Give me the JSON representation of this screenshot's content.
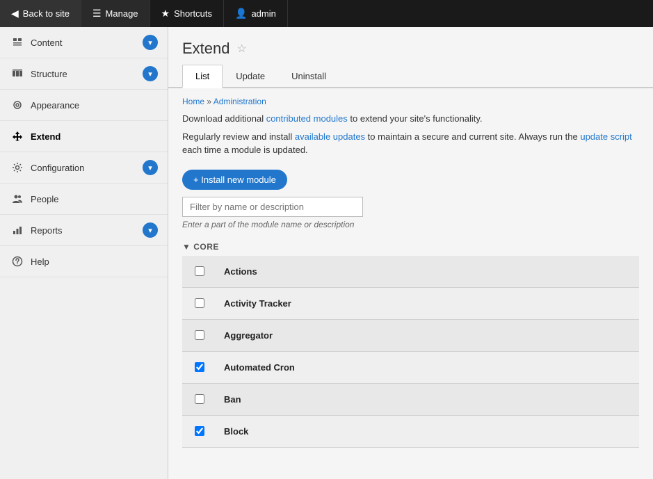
{
  "topNav": {
    "items": [
      {
        "id": "back-to-site",
        "label": "Back to site",
        "icon": "◀",
        "active": false
      },
      {
        "id": "manage",
        "label": "Manage",
        "icon": "☰",
        "active": true
      },
      {
        "id": "shortcuts",
        "label": "Shortcuts",
        "icon": "★",
        "active": false
      },
      {
        "id": "admin",
        "label": "admin",
        "icon": "👤",
        "active": false
      }
    ]
  },
  "sidebar": {
    "items": [
      {
        "id": "content",
        "label": "Content",
        "icon": "📄",
        "hasExpand": true,
        "active": false
      },
      {
        "id": "structure",
        "label": "Structure",
        "icon": "⚙",
        "hasExpand": true,
        "active": false
      },
      {
        "id": "appearance",
        "label": "Appearance",
        "icon": "🎨",
        "hasExpand": false,
        "active": false
      },
      {
        "id": "extend",
        "label": "Extend",
        "icon": "🧩",
        "hasExpand": false,
        "active": true
      },
      {
        "id": "configuration",
        "label": "Configuration",
        "icon": "🔧",
        "hasExpand": true,
        "active": false
      },
      {
        "id": "people",
        "label": "People",
        "icon": "👥",
        "hasExpand": false,
        "active": false
      },
      {
        "id": "reports",
        "label": "Reports",
        "icon": "📊",
        "hasExpand": true,
        "active": false
      },
      {
        "id": "help",
        "label": "Help",
        "icon": "❓",
        "hasExpand": false,
        "active": false
      }
    ]
  },
  "page": {
    "title": "Extend",
    "starLabel": "☆",
    "tabs": [
      {
        "id": "list",
        "label": "List",
        "active": true
      },
      {
        "id": "update",
        "label": "Update",
        "active": false
      },
      {
        "id": "uninstall",
        "label": "Uninstall",
        "active": false
      }
    ],
    "breadcrumb": {
      "home": "Home",
      "separator": " » ",
      "admin": "Administration"
    },
    "description1": "Download additional contributed modules to extend your site's functionality.",
    "description2_prefix": "Regularly review and install ",
    "description2_link1": "available updates",
    "description2_middle": " to maintain a secure and current site. Always run the ",
    "description2_link2": "update script",
    "description2_suffix": " each time a module is updated.",
    "installBtn": "+ Install new module",
    "filterPlaceholder": "Filter by name or description",
    "filterHint": "Enter a part of the module name or description",
    "sectionLabel": "▼ CORE",
    "modules": [
      {
        "id": "actions",
        "label": "Actions",
        "checked": false
      },
      {
        "id": "activity-tracker",
        "label": "Activity Tracker",
        "checked": false
      },
      {
        "id": "aggregator",
        "label": "Aggregator",
        "checked": false
      },
      {
        "id": "automated-cron",
        "label": "Automated Cron",
        "checked": true
      },
      {
        "id": "ban",
        "label": "Ban",
        "checked": false
      },
      {
        "id": "block",
        "label": "Block",
        "checked": true
      }
    ]
  }
}
